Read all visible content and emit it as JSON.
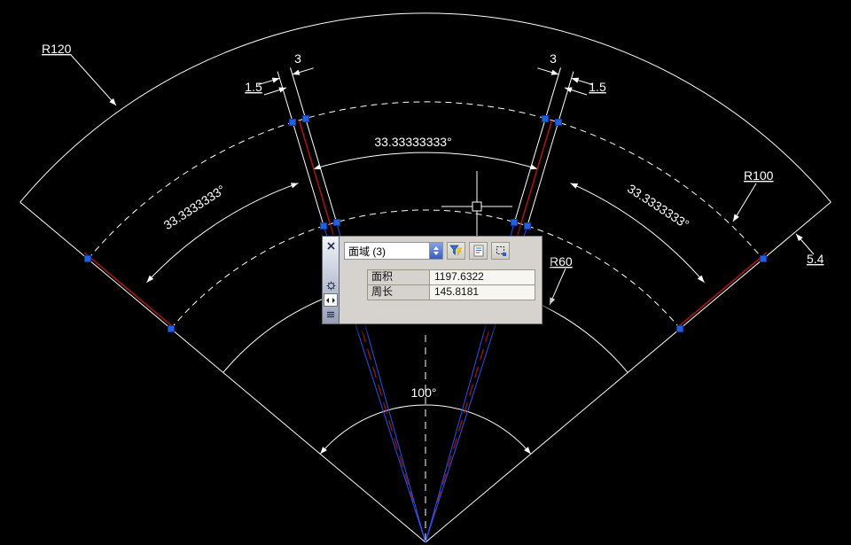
{
  "labels": {
    "r120": "R120",
    "r100": "R100",
    "r60": "R60",
    "gap": "5.4",
    "slot_width_left": "3",
    "slot_offset_left": "1.5",
    "slot_width_right": "3",
    "slot_offset_right": "1.5",
    "angle_between_slots": "33.33333333°",
    "angle_left": "33.3333333°",
    "angle_right": "33.3333333°",
    "angle_total": "100°"
  },
  "panel": {
    "selector": "面域 (3)",
    "rows": [
      {
        "label": "面积",
        "value": "1197.6322"
      },
      {
        "label": "周长",
        "value": "145.8181"
      }
    ]
  },
  "icons": {
    "close": "x-cross",
    "settings": "gear",
    "customize": "left-right-arrows",
    "options": "menu-lines",
    "filter": "blue-funnel-lightning",
    "properties_sheet": "document-lines",
    "selection": "dashed-square"
  },
  "colors": {
    "background": "#000000",
    "geometry": "#ffffff",
    "selected_red": "#a31515",
    "selected_blue": "#2b50f0",
    "grip_blue": "#2160e0",
    "panel_bg": "#d6d3ce"
  }
}
